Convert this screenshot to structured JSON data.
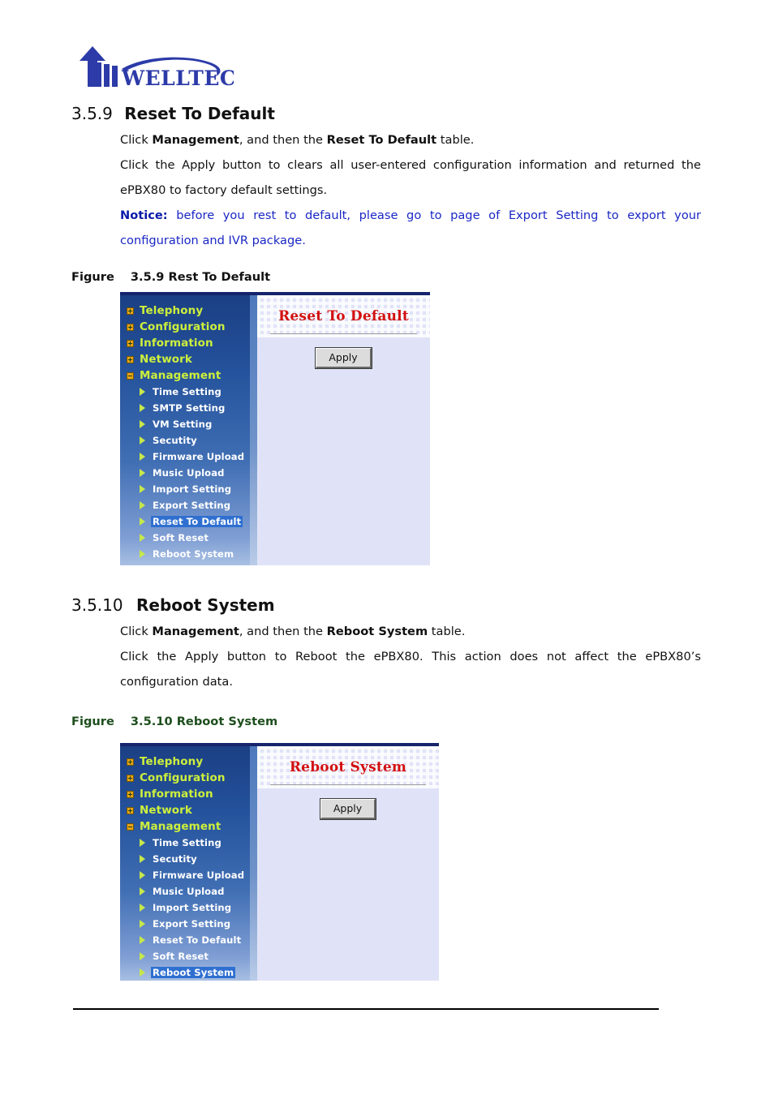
{
  "brand": {
    "name": "WELLTECH",
    "logo_color": "#2c3ba8",
    "icon": "welltech-arrow-logo"
  },
  "sections": [
    {
      "number": "3.5.9",
      "title": "Reset To Default",
      "paragraphs": {
        "p1_a": "Click ",
        "p1_b": "Management",
        "p1_c": ", and then the ",
        "p1_d": "Reset To Default",
        "p1_e": " table.",
        "p2": "Click the Apply button to clears all user-entered configuration information and returned the ePBX80 to factory default settings.",
        "notice_label": "Notice:",
        "notice_text": " before you rest to default, please go to page of Export Setting to export your configuration and IVR package."
      },
      "figure": {
        "caption_lead": "Figure",
        "caption_text": "3.5.9 Rest To Default",
        "caption_color": "#111111"
      }
    },
    {
      "number": "3.5.10",
      "title": "Reboot System",
      "paragraphs": {
        "p1_a": "Click ",
        "p1_b": "Management",
        "p1_c": ", and then the ",
        "p1_d": "Reboot System",
        "p1_e": " table.",
        "p2": "Click the Apply button to Reboot the ePBX80. This action does not affect the ePBX80’s configuration data.",
        "notice_label": "",
        "notice_text": ""
      },
      "figure": {
        "caption_lead": "Figure",
        "caption_text": "3.5.10 Reboot System",
        "caption_color": "#1d4e1d"
      }
    }
  ],
  "screenshot_1": {
    "panel_title": "Reset To Default",
    "panel_title_color": "#d31010",
    "apply_label": "Apply",
    "nav": {
      "top_items": [
        {
          "label": "Telephony",
          "expander": "plus-icon"
        },
        {
          "label": "Configuration",
          "expander": "plus-icon"
        },
        {
          "label": "Information",
          "expander": "plus-icon"
        },
        {
          "label": "Network",
          "expander": "plus-icon"
        },
        {
          "label": "Management",
          "expander": "minus-icon"
        }
      ],
      "sub_items": [
        {
          "label": "Time Setting",
          "selected": false
        },
        {
          "label": "SMTP Setting",
          "selected": false
        },
        {
          "label": "VM Setting",
          "selected": false
        },
        {
          "label": "Secutity",
          "selected": false
        },
        {
          "label": "Firmware Upload",
          "selected": false
        },
        {
          "label": "Music Upload",
          "selected": false
        },
        {
          "label": "Import Setting",
          "selected": false
        },
        {
          "label": "Export Setting",
          "selected": false
        },
        {
          "label": "Reset To Default",
          "selected": true
        },
        {
          "label": "Soft Reset",
          "selected": false
        },
        {
          "label": "Reboot System",
          "selected": false
        }
      ]
    }
  },
  "screenshot_2": {
    "panel_title": "Reboot System",
    "panel_title_color": "#d31010",
    "apply_label": "Apply",
    "nav": {
      "top_items": [
        {
          "label": "Telephony",
          "expander": "plus-icon"
        },
        {
          "label": "Configuration",
          "expander": "plus-icon"
        },
        {
          "label": "Information",
          "expander": "plus-icon"
        },
        {
          "label": "Network",
          "expander": "plus-icon"
        },
        {
          "label": "Management",
          "expander": "minus-icon"
        }
      ],
      "sub_items": [
        {
          "label": "Time Setting",
          "selected": false
        },
        {
          "label": "Secutity",
          "selected": false
        },
        {
          "label": "Firmware Upload",
          "selected": false
        },
        {
          "label": "Music Upload",
          "selected": false
        },
        {
          "label": "Import Setting",
          "selected": false
        },
        {
          "label": "Export Setting",
          "selected": false
        },
        {
          "label": "Reset To Default",
          "selected": false
        },
        {
          "label": "Soft Reset",
          "selected": false
        },
        {
          "label": "Reboot System",
          "selected": true
        }
      ]
    }
  }
}
